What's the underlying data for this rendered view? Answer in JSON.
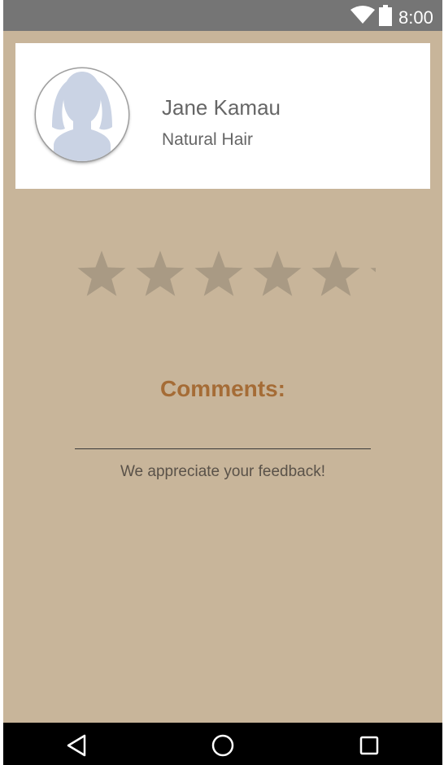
{
  "status_bar": {
    "time": "8:00",
    "icons": [
      "wifi-icon",
      "battery-icon"
    ],
    "color": "#757575"
  },
  "profile": {
    "name": "Jane Kamau",
    "category": "Natural Hair",
    "avatar_icon": "female-silhouette-icon"
  },
  "rating": {
    "max_stars": 5,
    "value": 0,
    "star_color": "#a99a84"
  },
  "comments": {
    "label": "Comments:",
    "value": "",
    "placeholder": "",
    "feedback_message": "We appreciate your feedback!",
    "label_color": "#a56c36"
  },
  "nav_bar": {
    "buttons": [
      "back-icon",
      "home-icon",
      "recents-icon"
    ]
  },
  "colors": {
    "background": "#c8b59a",
    "card": "#ffffff",
    "nav_bar": "#000000"
  }
}
